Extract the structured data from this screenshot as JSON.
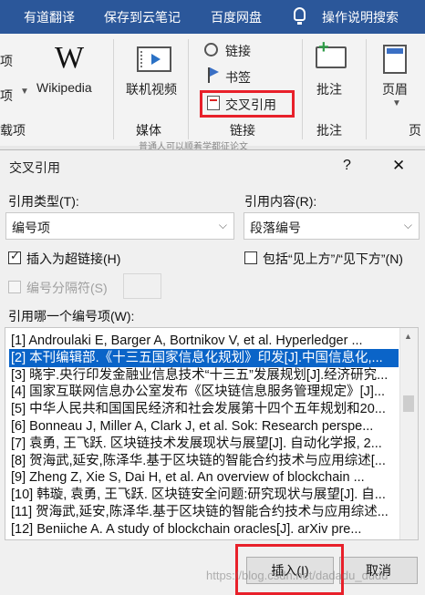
{
  "ribbon": {
    "tabs": [
      "有道翻译",
      "保存到云笔记",
      "百度网盘",
      "操作说明搜索"
    ],
    "left_partial": [
      "项",
      "项",
      "载项"
    ],
    "wikipedia": "Wikipedia",
    "online_video": "联机视频",
    "media_group": "媒体",
    "link": "链接",
    "bookmark": "书签",
    "cross_ref": "交叉引用",
    "links_group": "链接",
    "comment": "批注",
    "comments_group": "批注",
    "header": "页眉",
    "page_group_partial": "页"
  },
  "background_text": "普通人可以顺着学都征论文",
  "dialog": {
    "title": "交叉引用",
    "help": "?",
    "close": "✕",
    "ref_type_label": "引用类型(T):",
    "ref_type_value": "编号项",
    "ref_content_label": "引用内容(R):",
    "ref_content_value": "段落编号",
    "insert_hyperlink": "插入为超链接(H)",
    "insert_hyperlink_checked": true,
    "include_above_below": "包括“见上方”/“见下方”(N)",
    "include_above_below_checked": false,
    "number_separator": "编号分隔符(S)",
    "which_item_label": "引用哪一个编号项(W):",
    "items": [
      "[1] Androulaki E, Barger A, Bortnikov V, et al. Hyperledger ...",
      "[2] 本刊编辑部.《十三五国家信息化规划》印发[J].中国信息化,...",
      "[3] 晓宇.央行印发金融业信息技术“十三五”发展规划[J].经济研究...",
      "[4] 国家互联网信息办公室发布《区块链信息服务管理规定》[J]...",
      "[5] 中华人民共和国国民经济和社会发展第十四个五年规划和20...",
      "[6] Bonneau J, Miller A, Clark J, et al. Sok: Research perspe...",
      "[7] 袁勇, 王飞跃. 区块链技术发展现状与展望[J]. 自动化学报, 2...",
      "[8] 贺海武,延安,陈泽华.基于区块链的智能合约技术与应用综述[...",
      "[9] Zheng Z, Xie S, Dai H, et al. An overview of blockchain ...",
      "[10] 韩璇, 袁勇, 王飞跃. 区块链安全问题:研究现状与展望[J]. 自...",
      "[11] 贺海武,延安,陈泽华.基于区块链的智能合约技术与应用综述...",
      "[12] Beniiche A. A study of blockchain oracles[J]. arXiv pre..."
    ],
    "selected_index": 1,
    "insert_button": "插入(I)",
    "cancel_button": "取消"
  },
  "watermark": "https://blog.csdn.net/dadadu_dudu"
}
